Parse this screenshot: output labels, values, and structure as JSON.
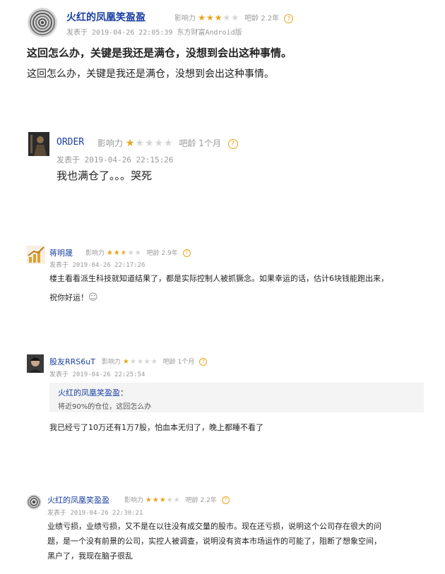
{
  "posts": [
    {
      "user": "火红的凤凰笑盈盈",
      "influence_label": "影响力",
      "stars_on": 3,
      "stars_total": 5,
      "age_label": "吧龄",
      "age_value": "2.2年",
      "help_glyph": "?",
      "date_prefix": "发表于",
      "datetime": "2019-04-26 22:05:39",
      "source": "东方财富Android版",
      "title": "这回怎么办，关键是我还是满仓，没想到会出这种事情。",
      "body": "这回怎么办，关键是我还是满仓，没想到会出这种事情。",
      "avatar_icon": "spiral-avatar-icon"
    },
    {
      "user": "ORDER",
      "influence_label": "影响力",
      "stars_on": 1,
      "stars_total": 5,
      "age_label": "吧龄",
      "age_value": "1个月",
      "help_glyph": "?",
      "date_prefix": "发表于",
      "datetime": "2019-04-26 22:15:26",
      "body": "我也满仓了。。。哭死",
      "avatar_icon": "dark-figure-avatar-icon"
    },
    {
      "user": "蒋明晟",
      "influence_label": "影响力",
      "stars_on": 2.5,
      "stars_total": 5,
      "age_label": "吧龄",
      "age_value": "2.9年",
      "help_glyph": "?",
      "date_prefix": "发表于",
      "datetime": "2019-04-26 22:17:26",
      "body_line1": "楼主看看派生科技就知道结果了，都是实际控制人被抓獗念。如果幸运的话，估计6块钱能跑出来，",
      "body_line2": "祝你好运！",
      "sticker_glyph": "☺",
      "avatar_icon": "chart-avatar-icon"
    },
    {
      "user": "股友RRS6uT",
      "influence_label": "影响力",
      "stars_on": 1,
      "stars_total": 5,
      "age_label": "吧龄",
      "age_value": "1个月",
      "help_glyph": "?",
      "date_prefix": "发表于",
      "datetime": "2019-04-26 22:25:54",
      "quote_user": "火红的凤凰笑盈盈",
      "quote_colon": "：",
      "quote_text": "将近90%的仓位，这回怎么办",
      "body": "我已经亏了10万还有1万7股，怕血本无归了，晚上都睡不看了",
      "avatar_icon": "face-avatar-icon"
    },
    {
      "user": "火红的凤凰笑盈盈",
      "influence_label": "影响力",
      "stars_on": 3,
      "stars_total": 5,
      "age_label": "吧龄",
      "age_value": "2.2年",
      "help_glyph": "?",
      "date_prefix": "发表于",
      "datetime": "2019-04-26 22:30:21",
      "body_line1": "业绩亏损，业绩亏损，又不是在以往没有成交量的股市。现在还亏损，说明这个公司存在很大的问",
      "body_line2": "题，是一个没有前景的公司，实控人被调查，说明没有资本市场运作的可能了，阻断了想象空间，",
      "body_line3": "黑户了，我现在脑子很乱",
      "avatar_icon": "spiral-avatar-icon"
    }
  ],
  "colors": {
    "name": "#1a3fa0",
    "star": "#e8a417",
    "star_off": "#d4d4d4",
    "meta": "#999999"
  }
}
